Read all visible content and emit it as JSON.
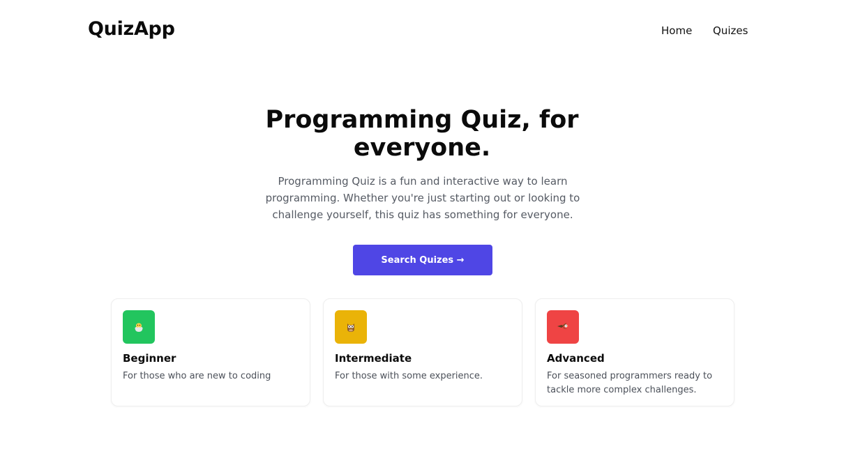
{
  "app": {
    "logo": "QuizApp"
  },
  "nav": {
    "items": [
      {
        "label": "Home"
      },
      {
        "label": "Quizes"
      }
    ]
  },
  "hero": {
    "title": "Programming Quiz, for everyone.",
    "description": "Programming Quiz is a fun and interactive way to learn programming. Whether you're just starting out or looking to challenge yourself, this quiz has something for everyone.",
    "cta_label": "Search Quizes →"
  },
  "colors": {
    "accent": "#4f46e5",
    "beginner": "#22c55e",
    "intermediate": "#eab308",
    "advanced": "#ef4444"
  },
  "levels": [
    {
      "title": "Beginner",
      "description": "For those who are new to coding",
      "icon": "hatching-chick-icon",
      "color": "#22c55e"
    },
    {
      "title": "Intermediate",
      "description": "For those with some experience.",
      "icon": "owl-icon",
      "color": "#eab308"
    },
    {
      "title": "Advanced",
      "description": "For seasoned programmers ready to tackle more complex challenges.",
      "icon": "eagle-icon",
      "color": "#ef4444"
    }
  ]
}
